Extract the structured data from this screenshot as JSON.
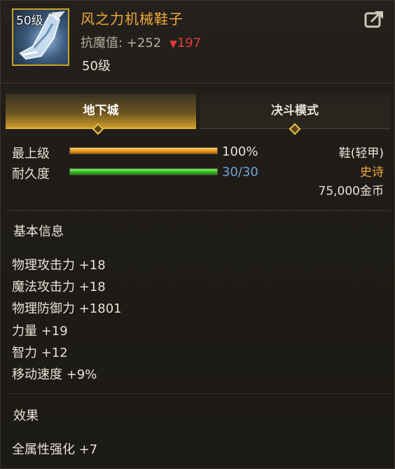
{
  "item": {
    "level_badge": "50级",
    "name": "风之力机械鞋子",
    "resist_label": "抗魔值: +252",
    "resist_down": "197",
    "required_level": "50级"
  },
  "tabs": [
    {
      "label": "地下城",
      "active": true
    },
    {
      "label": "决斗模式",
      "active": false
    }
  ],
  "stats": {
    "grade_label": "最上级",
    "grade_value": "100%",
    "grade_pct": 100,
    "durability_label": "耐久度",
    "durability_value": "30/30",
    "durability_pct": 100
  },
  "meta": {
    "type": "鞋(轻甲)",
    "rarity": "史诗",
    "price": "75,000金币"
  },
  "basic_info": {
    "title": "基本信息",
    "attrs": [
      "物理攻击力 +18",
      "魔法攻击力 +18",
      "物理防御力 +1801",
      "力量 +19",
      "智力 +12",
      "移动速度 +9%"
    ]
  },
  "effects": {
    "title": "效果",
    "items": [
      "全属性强化 +7"
    ]
  },
  "colors": {
    "title": "#f0a93a",
    "rarity": "#f0a93a",
    "down": "#e23b3b",
    "durability": "#6ea3d8"
  },
  "icons": {
    "share": "share-icon",
    "item": "mechanical-boots-icon"
  }
}
